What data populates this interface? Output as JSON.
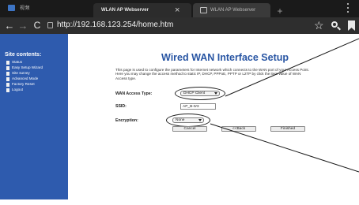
{
  "status_bar": {
    "text": "视频"
  },
  "tabs": [
    {
      "label": "WLAN AP Webserver",
      "close_glyph": "×"
    },
    {
      "label": "WLAN AP Webserver"
    }
  ],
  "new_tab_glyph": "+",
  "toolbar": {
    "back_glyph": "←",
    "forward_glyph": "→",
    "reload_glyph": "C",
    "url": "http://192.168.123.254/home.htm",
    "star_glyph": "☆"
  },
  "sidebar": {
    "title": "Site contents:",
    "items": [
      {
        "label": "Status"
      },
      {
        "label": "Easy Setup Wizard"
      },
      {
        "label": "Site survey"
      },
      {
        "label": "Advanced Mode"
      },
      {
        "label": "Factory Reset"
      },
      {
        "label": "Logout"
      }
    ]
  },
  "main": {
    "title": "Wired WAN Interface Setup",
    "description": "This page is used to configure the parameters for Internet network which connects to the WAN port of your Access Point. Here you may change the access method to static IP, DHCP, PPPoE, PPTP or L2TP by click the item value of WAN Access type.",
    "access_type_label": "WAN Access Type:",
    "access_type_value": "DHCP Client",
    "ssid_label": "SSID:",
    "ssid_value": "AP_B-0/3",
    "encryption_label": "Encryption:",
    "encryption_value": "None",
    "buttons": {
      "cancel": "Cancel",
      "back": "<<Back",
      "finished": "Finished"
    }
  },
  "colors": {
    "sidebar_bg": "#2e5bae",
    "title_blue": "#2855a3",
    "chrome_dark": "#2e2e2e",
    "status_bar": "#1a1a1a"
  }
}
